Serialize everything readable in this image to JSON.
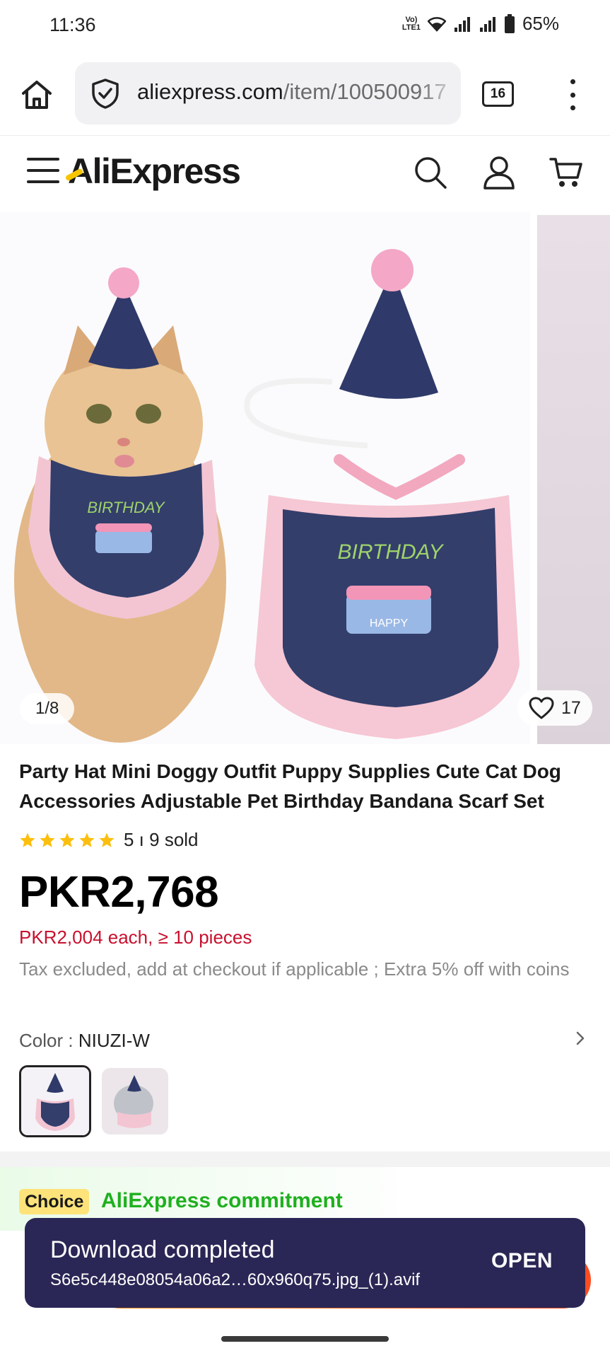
{
  "status_bar": {
    "time": "11:36",
    "battery": "65%",
    "volte": "VoLTE1"
  },
  "browser": {
    "url_domain": "aliexpress.com",
    "url_path": "/item/100500917",
    "tab_count": "16"
  },
  "site": {
    "logo": "AliExpress"
  },
  "gallery": {
    "counter": "1/8",
    "wishlist_count": "17"
  },
  "product": {
    "title": "Party Hat Mini Doggy Outfit Puppy Supplies Cute Cat Dog Accessories Adjustable Pet Birthday Bandana Scarf Set",
    "rating_stars": 5,
    "rating_text": "5 ı 9 sold",
    "price": "PKR2,768",
    "bulk_price": "PKR2,004 each, ≥ 10 pieces",
    "tax_note": "Tax excluded, add at checkout if applicable ; Extra 5% off with coins",
    "color_label": "Color : ",
    "color_value": "NIUZI-W",
    "embroidery_bib": "BIRTHDAY",
    "embroidery_cake": "HAPPY"
  },
  "choice": {
    "badge": "Choice",
    "text": "AliExpress commitment"
  },
  "toast": {
    "title": "Download completed",
    "filename": "S6e5c448e08054a06a2…60x960q75.jpg_(1).avif",
    "action": "OPEN"
  },
  "colors": {
    "price_red": "#c8102e",
    "choice_green": "#1fb01f",
    "choice_badge": "#fde37a",
    "toast_bg": "#2a2756",
    "star": "#fcbf0f"
  }
}
